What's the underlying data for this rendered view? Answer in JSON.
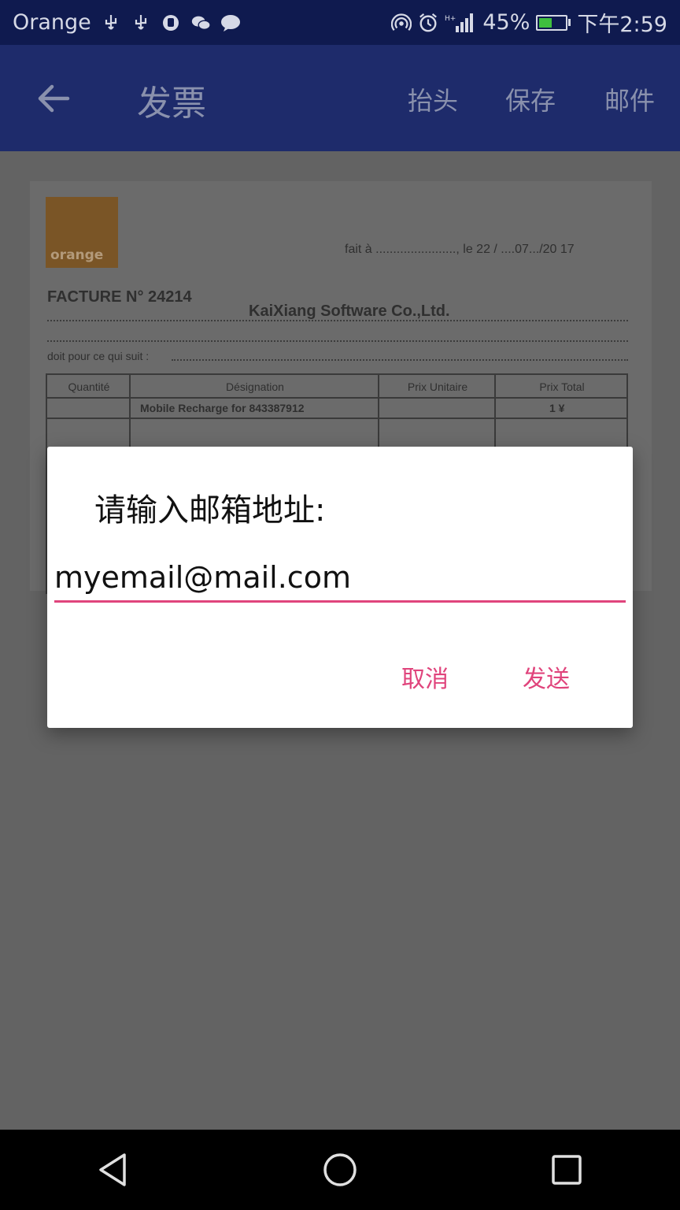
{
  "status_bar": {
    "carrier": "Orange",
    "battery_percent": "45%",
    "battery_level": 0.45,
    "time": "下午2:59",
    "icons": [
      "usb-icon",
      "usb-icon",
      "hand-icon",
      "wechat-icon",
      "message-icon",
      "hotspot-icon",
      "alarm-icon",
      "signal-icon",
      "battery-icon"
    ]
  },
  "app_bar": {
    "title": "发票",
    "actions": [
      "抬头",
      "保存",
      "邮件"
    ]
  },
  "document": {
    "logo_text": "orange",
    "fait_text": "fait à ......................., le  22  /  ....07.../20 17",
    "facture": "FACTURE N°  24214",
    "company": "KaiXiang Software Co.,Ltd.",
    "doit": "doit pour ce qui suit : ",
    "columns": [
      "Quantité",
      "Désignation",
      "Prix Unitaire",
      "Prix Total"
    ],
    "rows": [
      [
        "",
        "Mobile Recharge for 843387912",
        "",
        "1 ¥"
      ]
    ]
  },
  "dialog": {
    "title": "请输入邮箱地址:",
    "email_value": "myemail@mail.com",
    "cancel_label": "取消",
    "send_label": "发送",
    "accent_color": "#e0447c"
  }
}
